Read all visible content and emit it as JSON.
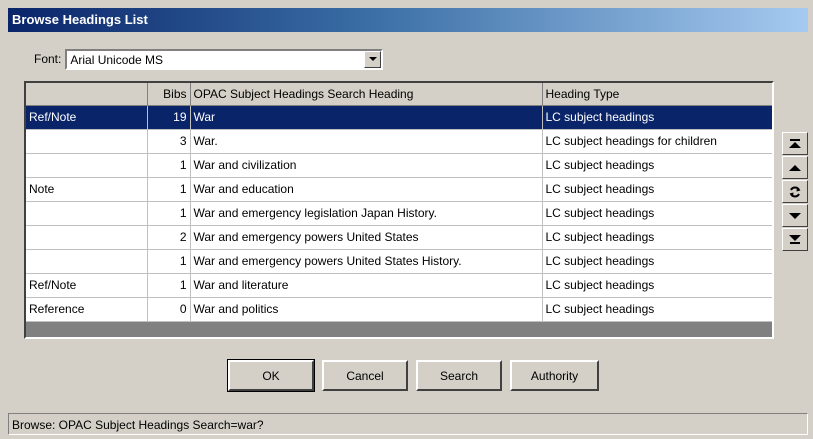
{
  "window": {
    "title": "Browse Headings List"
  },
  "font": {
    "label": "Font:",
    "value": "Arial Unicode MS"
  },
  "table": {
    "columns": [
      "",
      "Bibs",
      "OPAC Subject Headings Search Heading",
      "Heading Type"
    ],
    "rows": [
      {
        "ref": "Ref/Note",
        "bibs": "19",
        "heading": "War",
        "type": "LC subject headings",
        "selected": true
      },
      {
        "ref": "",
        "bibs": "3",
        "heading": "War.",
        "type": "LC subject headings for children"
      },
      {
        "ref": "",
        "bibs": "1",
        "heading": "War and civilization",
        "type": "LC subject headings"
      },
      {
        "ref": "Note",
        "bibs": "1",
        "heading": "War and education",
        "type": "LC subject headings"
      },
      {
        "ref": "",
        "bibs": "1",
        "heading": "War and emergency legislation Japan History.",
        "type": "LC subject headings"
      },
      {
        "ref": "",
        "bibs": "2",
        "heading": "War and emergency powers United States",
        "type": "LC subject headings"
      },
      {
        "ref": "",
        "bibs": "1",
        "heading": "War and emergency powers United States History.",
        "type": "LC subject headings"
      },
      {
        "ref": "Ref/Note",
        "bibs": "1",
        "heading": "War and literature",
        "type": "LC subject headings"
      },
      {
        "ref": "Reference",
        "bibs": "0",
        "heading": "War and politics",
        "type": "LC subject headings"
      }
    ]
  },
  "side_buttons": [
    "first-page-icon",
    "page-up-icon",
    "refresh-icon",
    "page-down-icon",
    "last-page-icon"
  ],
  "buttons": {
    "ok": "OK",
    "cancel": "Cancel",
    "search": "Search",
    "authority": "Authority"
  },
  "status": {
    "text": "Browse: OPAC Subject Headings Search=war?"
  },
  "colors": {
    "selection": "#0a246a",
    "face": "#d4d0c8"
  }
}
